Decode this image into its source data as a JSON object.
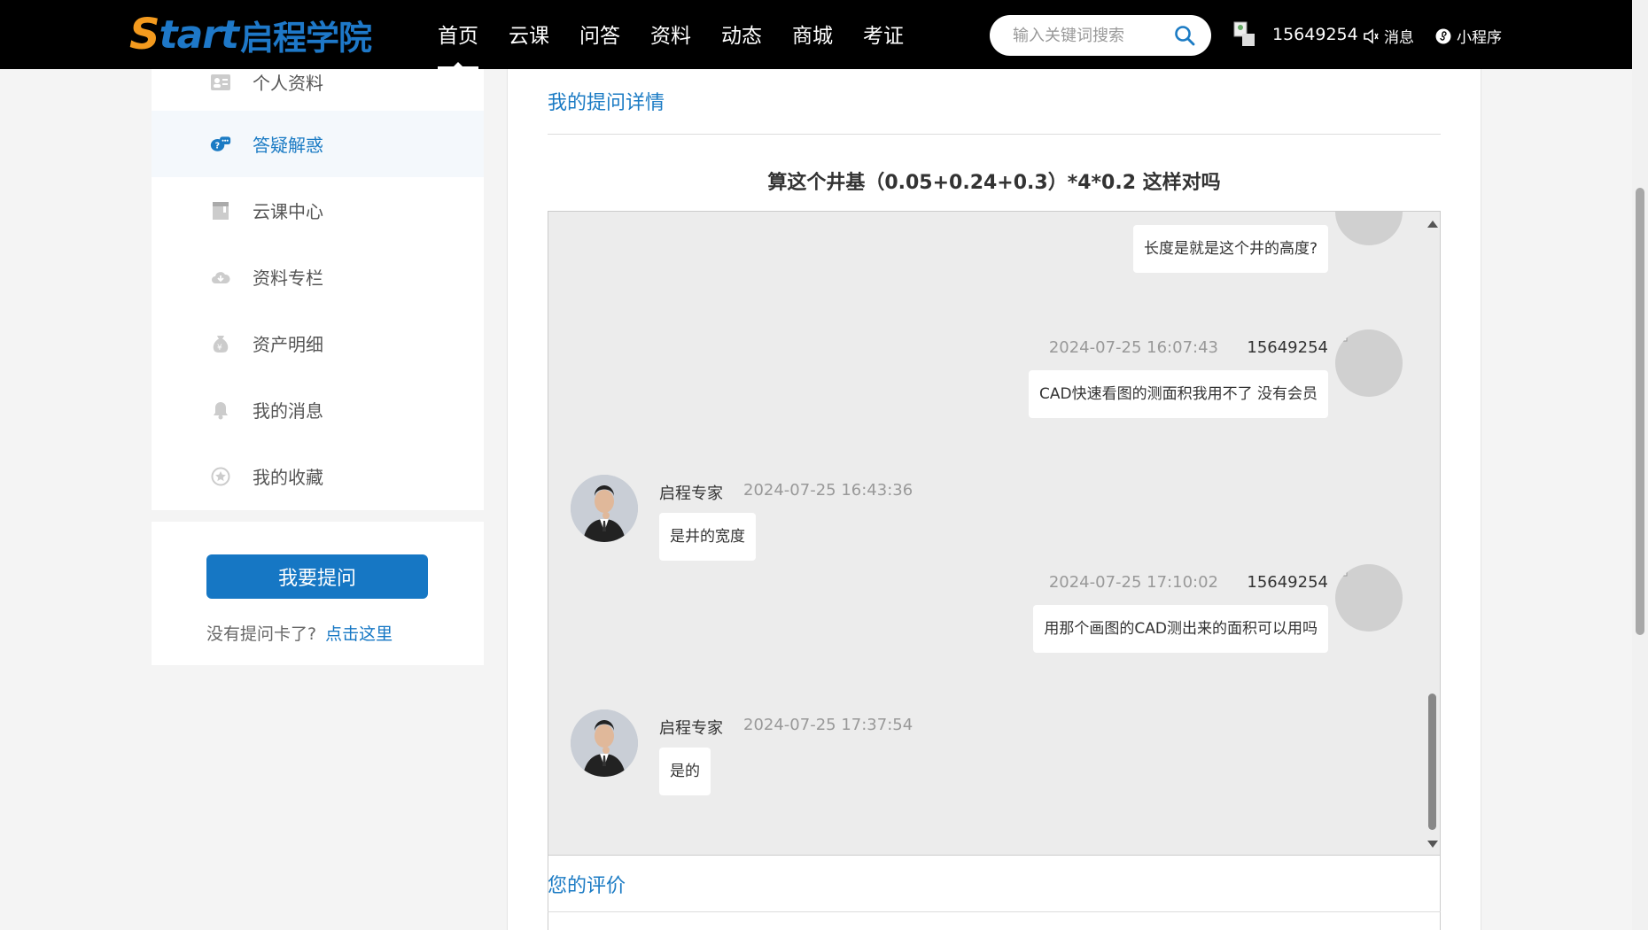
{
  "header": {
    "logo_start": "Start",
    "logo_cn": "启程学院",
    "nav": [
      "首页",
      "云课",
      "问答",
      "资料",
      "动态",
      "商城",
      "考证"
    ],
    "search_placeholder": "输入关键词搜索",
    "user_id": "15649254",
    "messages_label": "消息",
    "miniprogram_label": "小程序"
  },
  "sidebar": {
    "items": [
      {
        "label": "个人资料",
        "icon": "profile-card-icon"
      },
      {
        "label": "答疑解惑",
        "icon": "qa-chat-icon"
      },
      {
        "label": "云课中心",
        "icon": "book-icon"
      },
      {
        "label": "资料专栏",
        "icon": "cloud-download-icon"
      },
      {
        "label": "资产明细",
        "icon": "money-bag-icon"
      },
      {
        "label": "我的消息",
        "icon": "bell-icon"
      },
      {
        "label": "我的收藏",
        "icon": "star-circle-icon"
      }
    ],
    "ask_button": "我要提问",
    "no_card_text": "没有提问卡了?",
    "no_card_link": "点击这里"
  },
  "main": {
    "title": "我的提问详情",
    "question": "算这个井基（0.05+0.24+0.3）*4*0.2 这样对吗",
    "rating_title": "您的评价"
  },
  "chat": {
    "messages": [
      {
        "side": "right",
        "text": "长度是就是这个井的高度?"
      },
      {
        "side": "right",
        "name": "15649254",
        "time": "2024-07-25 16:07:43",
        "text": "CAD快速看图的测面积我用不了 没有会员"
      },
      {
        "side": "left",
        "name": "启程专家",
        "time": "2024-07-25 16:43:36",
        "text": "是井的宽度"
      },
      {
        "side": "right",
        "name": "15649254",
        "time": "2024-07-25 17:10:02",
        "text": "用那个画图的CAD测出来的面积可以用吗"
      },
      {
        "side": "left",
        "name": "启程专家",
        "time": "2024-07-25 17:37:54",
        "text": "是的"
      }
    ]
  },
  "colors": {
    "accent": "#1b7bc4",
    "button": "#1677c4",
    "topbar": "#000000",
    "logo_orange": "#f39a1e"
  }
}
